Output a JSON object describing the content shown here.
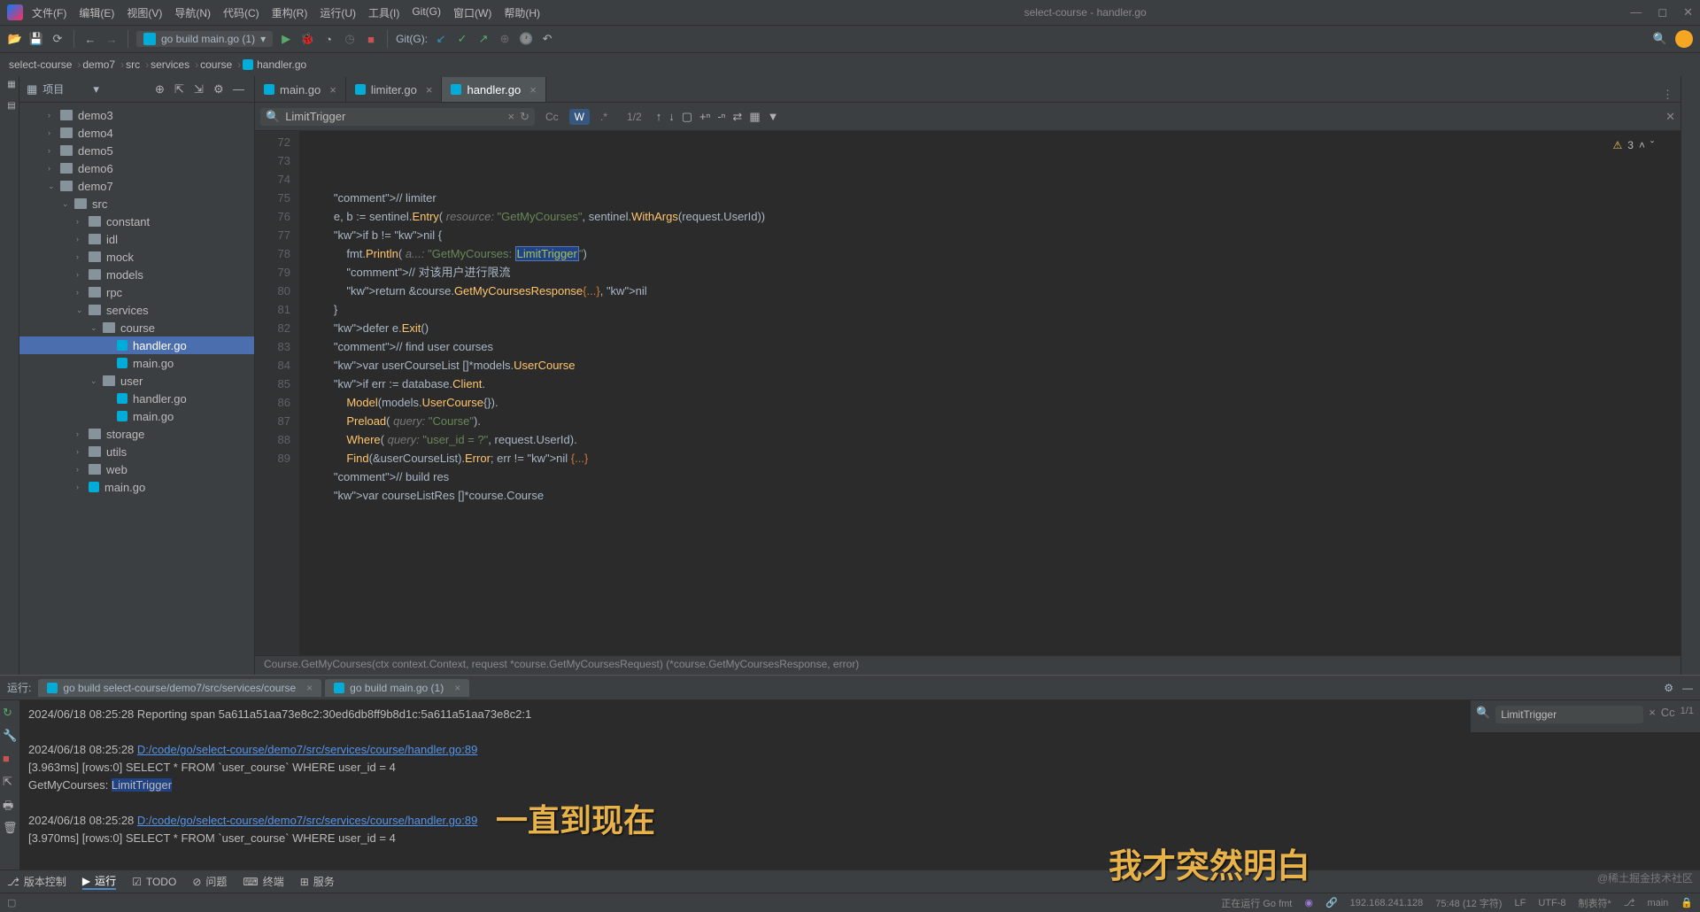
{
  "window": {
    "title": "select-course - handler.go"
  },
  "menu": [
    "文件(F)",
    "编辑(E)",
    "视图(V)",
    "导航(N)",
    "代码(C)",
    "重构(R)",
    "运行(U)",
    "工具(I)",
    "Git(G)",
    "窗口(W)",
    "帮助(H)"
  ],
  "runConfig": "go build main.go (1)",
  "gitLabel": "Git(G):",
  "breadcrumbs": [
    "select-course",
    "demo7",
    "src",
    "services",
    "course",
    "handler.go"
  ],
  "projectTitle": "项目",
  "tree": [
    {
      "indent": 2,
      "arrow": "›",
      "kind": "folder",
      "label": "demo3"
    },
    {
      "indent": 2,
      "arrow": "›",
      "kind": "folder",
      "label": "demo4"
    },
    {
      "indent": 2,
      "arrow": "›",
      "kind": "folder",
      "label": "demo5"
    },
    {
      "indent": 2,
      "arrow": "›",
      "kind": "folder",
      "label": "demo6"
    },
    {
      "indent": 2,
      "arrow": "⌄",
      "kind": "folder",
      "label": "demo7"
    },
    {
      "indent": 3,
      "arrow": "⌄",
      "kind": "folder",
      "label": "src"
    },
    {
      "indent": 4,
      "arrow": "›",
      "kind": "folder",
      "label": "constant"
    },
    {
      "indent": 4,
      "arrow": "›",
      "kind": "folder",
      "label": "idl"
    },
    {
      "indent": 4,
      "arrow": "›",
      "kind": "folder",
      "label": "mock"
    },
    {
      "indent": 4,
      "arrow": "›",
      "kind": "folder",
      "label": "models"
    },
    {
      "indent": 4,
      "arrow": "›",
      "kind": "folder",
      "label": "rpc"
    },
    {
      "indent": 4,
      "arrow": "⌄",
      "kind": "folder",
      "label": "services"
    },
    {
      "indent": 5,
      "arrow": "⌄",
      "kind": "folder",
      "label": "course"
    },
    {
      "indent": 6,
      "arrow": "",
      "kind": "go",
      "label": "handler.go",
      "selected": true
    },
    {
      "indent": 6,
      "arrow": "",
      "kind": "go",
      "label": "main.go"
    },
    {
      "indent": 5,
      "arrow": "⌄",
      "kind": "folder",
      "label": "user"
    },
    {
      "indent": 6,
      "arrow": "",
      "kind": "go",
      "label": "handler.go"
    },
    {
      "indent": 6,
      "arrow": "",
      "kind": "go",
      "label": "main.go"
    },
    {
      "indent": 4,
      "arrow": "›",
      "kind": "folder",
      "label": "storage"
    },
    {
      "indent": 4,
      "arrow": "›",
      "kind": "folder",
      "label": "utils"
    },
    {
      "indent": 4,
      "arrow": "›",
      "kind": "folder",
      "label": "web"
    },
    {
      "indent": 4,
      "arrow": "›",
      "kind": "go",
      "label": "main.go"
    }
  ],
  "tabs": [
    {
      "label": "main.go",
      "active": false
    },
    {
      "label": "limiter.go",
      "active": false
    },
    {
      "label": "handler.go",
      "active": true
    }
  ],
  "search": {
    "query": "LimitTrigger",
    "count": "1/2"
  },
  "lineStart": 72,
  "codeLines": [
    "        // limiter",
    "        e, b := sentinel.Entry( resource: \"GetMyCourses\", sentinel.WithArgs(request.UserId))",
    "        if b != nil {",
    "            fmt.Println( a...: \"GetMyCourses: LimitTrigger\")",
    "            // 对该用户进行限流",
    "            return &course.GetMyCoursesResponse{...}, nil",
    "        }",
    "        defer e.Exit()",
    "        // find user courses",
    "        var userCourseList []*models.UserCourse",
    "        if err := database.Client.",
    "            Model(models.UserCourse{}).",
    "            Preload( query: \"Course\").",
    "            Where( query: \"user_id = ?\", request.UserId).",
    "            Find(&userCourseList).Error; err != nil {...}",
    "",
    "        // build res",
    "        var courseListRes []*course.Course"
  ],
  "inspectionCount": "3",
  "signature": "Course.GetMyCourses(ctx context.Context, request *course.GetMyCoursesRequest) (*course.GetMyCoursesResponse, error)",
  "runLabel": "运行:",
  "runTabs": [
    "go build select-course/demo7/src/services/course",
    "go build main.go (1)"
  ],
  "console": {
    "line1": "2024/06/18 08:25:28 Reporting span 5a611a51aa73e8c2:30ed6db8ff9b8d1c:5a611a51aa73e8c2:1",
    "line2a": "2024/06/18 08:25:28 ",
    "line2b": "D:/code/go/select-course/demo7/src/services/course/handler.go:89",
    "line3": "[3.963ms] [rows:0] SELECT * FROM `user_course` WHERE user_id = 4",
    "line4a": "GetMyCourses: ",
    "line4b": "LimitTrigger",
    "line5a": "2024/06/18 08:25:28 ",
    "line5b": "D:/code/go/select-course/demo7/src/services/course/handler.go:89",
    "line6": "[3.970ms] [rows:0] SELECT * FROM `user_course` WHERE user_id = 4"
  },
  "consoleSearch": {
    "query": "LimitTrigger",
    "count": "1/1"
  },
  "bottomTabs": [
    "版本控制",
    "运行",
    "TODO",
    "问题",
    "终端",
    "服务"
  ],
  "status": {
    "running": "正在运行 Go fmt",
    "ip": "192.168.241.128",
    "pos": "75:48 (12 字符)",
    "eol": "LF",
    "enc": "UTF-8",
    "spaces": "制表符*",
    "branch": "main"
  },
  "overlay1": "一直到现在",
  "overlay2": "我才突然明白",
  "watermark": "@稀土掘金技术社区"
}
